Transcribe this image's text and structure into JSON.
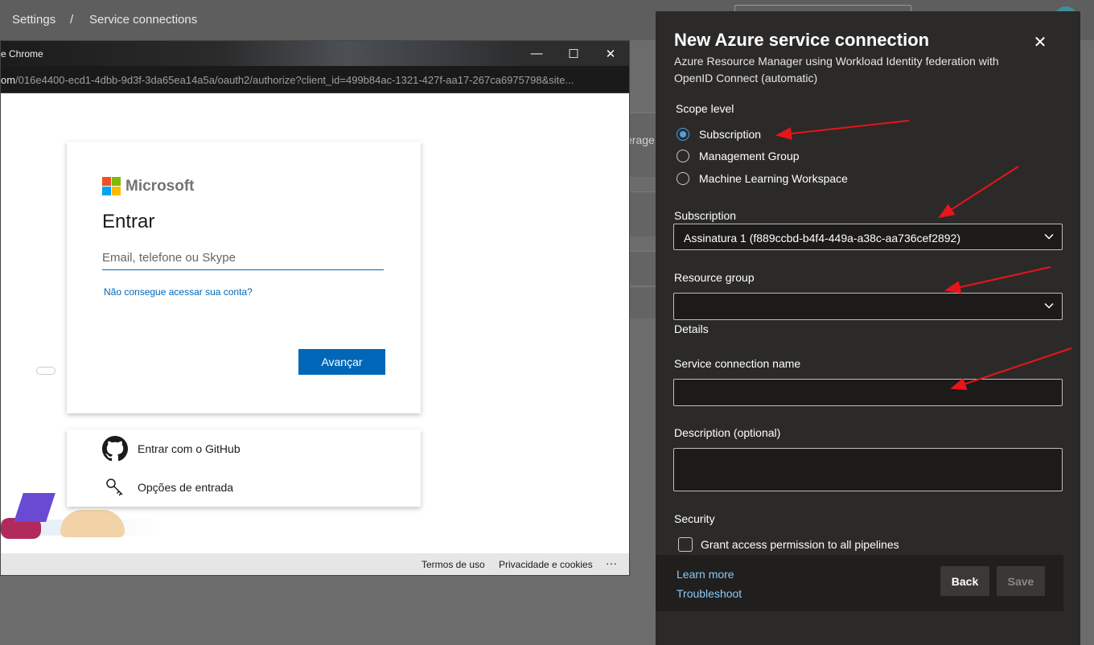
{
  "breadcrumb": {
    "settings": "Settings",
    "separator": "/",
    "service_connections": "Service connections"
  },
  "background": {
    "truncated_text": "erage"
  },
  "chrome_window": {
    "title": "e Chrome",
    "url_highlight": "om",
    "url_rest": "/016e4400-ecd1-4dbb-9d3f-3da65ea14a5a/oauth2/authorize?client_id=499b84ac-1321-427f-aa17-267ca6975798&site...",
    "controls": {
      "minimize": "—",
      "maximize": "☐",
      "close": "✕"
    }
  },
  "ms_login": {
    "brand": "Microsoft",
    "heading": "Entrar",
    "email_placeholder": "Email, telefone ou Skype",
    "cant_access_link": "Não consegue acessar sua conta?",
    "next_button": "Avançar",
    "github_option": "Entrar com o GitHub",
    "signin_options": "Opções de entrada",
    "logo_colors": [
      "#f25022",
      "#7fba00",
      "#00a4ef",
      "#ffb900"
    ]
  },
  "chrome_status": {
    "terms": "Termos de uso",
    "privacy": "Privacidade e cookies",
    "more": "···"
  },
  "panel": {
    "title": "New Azure service connection",
    "subtitle": "Azure Resource Manager using Workload Identity federation with OpenID Connect (automatic)",
    "close_icon": "✕",
    "scope_level_label": "Scope level",
    "scope_options": [
      {
        "label": "Subscription",
        "checked": true
      },
      {
        "label": "Management Group",
        "checked": false
      },
      {
        "label": "Machine Learning Workspace",
        "checked": false
      }
    ],
    "subscription_label": "Subscription",
    "subscription_value": "Assinatura 1 (f889ccbd-b4f4-449a-a38c-aa736cef2892)",
    "resource_group_label": "Resource group",
    "resource_group_value": "",
    "details_label": "Details",
    "service_connection_name_label": "Service connection name",
    "service_connection_name_value": "",
    "description_label": "Description (optional)",
    "description_value": "",
    "security_label": "Security",
    "grant_access_label": "Grant access permission to all pipelines",
    "grant_access_checked": false,
    "learn_more": "Learn more",
    "troubleshoot": "Troubleshoot",
    "back_button": "Back",
    "save_button": "Save",
    "accent_color": "#4aa2e4",
    "link_color": "#8cc8f5"
  },
  "annotation_color": "#e8141b"
}
